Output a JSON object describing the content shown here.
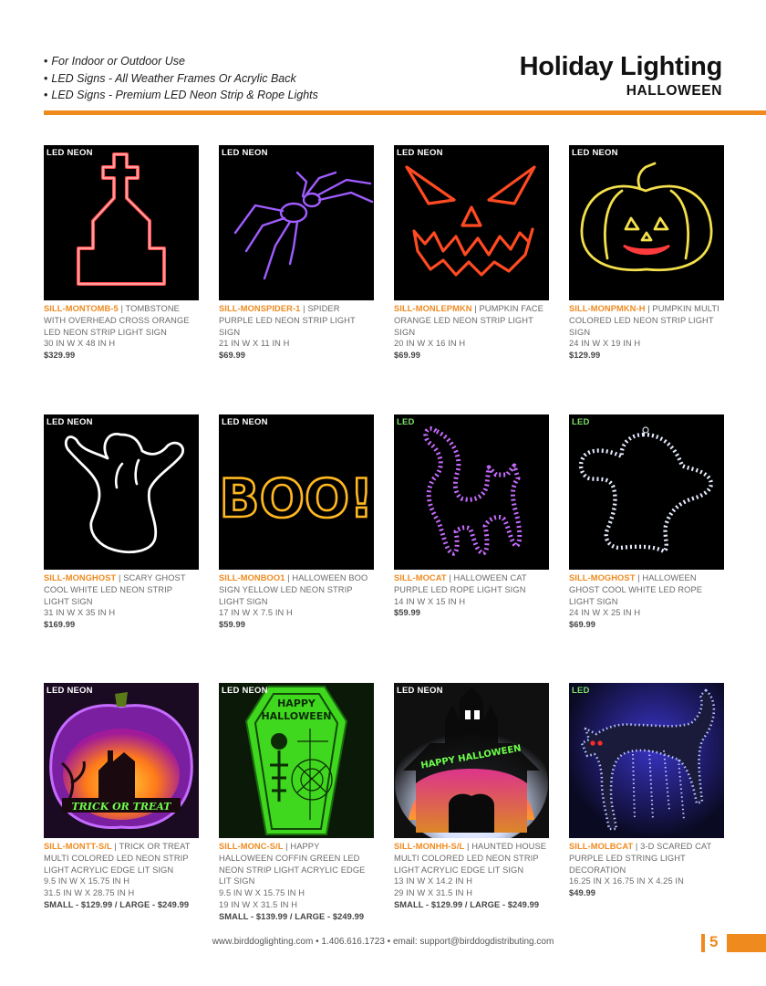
{
  "header": {
    "bullets": [
      "For Indoor or Outdoor Use",
      "LED Signs - All Weather Frames Or Acrylic Back",
      "LED Signs - Premium LED Neon Strip & Rope Lights"
    ],
    "title": "Holiday Lighting",
    "subtitle": "HALLOWEEN"
  },
  "colors": {
    "accent": "#ef8a1f",
    "led_tag": "#7ee06a"
  },
  "products": [
    {
      "tag": "LED NEON",
      "tag_type": "neon",
      "icon": "tombstone-cross-icon",
      "sku": "SILL-MONTOMB-5",
      "desc": "TOMBSTONE WITH OVERHEAD CROSS ORANGE LED NEON STRIP LIGHT SIGN",
      "dims": [
        "30 IN W X 48 IN H"
      ],
      "price": "$329.99"
    },
    {
      "tag": "LED NEON",
      "tag_type": "neon",
      "icon": "spider-icon",
      "sku": "SILL-MONSPIDER-1",
      "desc": "SPIDER PURPLE LED NEON STRIP LIGHT SIGN",
      "dims": [
        "21 IN W X 11 IN H"
      ],
      "price": "$69.99"
    },
    {
      "tag": "LED NEON",
      "tag_type": "neon",
      "icon": "pumpkin-face-icon",
      "sku": "SILL-MONLEPMKN",
      "desc": "PUMPKIN FACE ORANGE LED NEON STRIP LIGHT SIGN",
      "dims": [
        "20 IN W X 16 IN H"
      ],
      "price": "$69.99"
    },
    {
      "tag": "LED NEON",
      "tag_type": "neon",
      "icon": "pumpkin-icon",
      "sku": "SILL-MONPMKN-H",
      "desc": "PUMPKIN MULTI COLORED LED NEON STRIP LIGHT SIGN",
      "dims": [
        "24 IN W X 19 IN H"
      ],
      "price": "$129.99"
    },
    {
      "tag": "LED NEON",
      "tag_type": "neon",
      "icon": "scary-ghost-icon",
      "sku": "SILL-MONGHOST",
      "desc": "SCARY GHOST COOL WHITE LED NEON STRIP LIGHT SIGN",
      "dims": [
        "31 IN W X 35 IN H"
      ],
      "price": "$169.99"
    },
    {
      "tag": "LED NEON",
      "tag_type": "neon",
      "icon": "boo-text-icon",
      "sku": "SILL-MONBOO1",
      "desc": "HALLOWEEN BOO SIGN YELLOW LED NEON STRIP LIGHT SIGN",
      "dims": [
        "17 IN W X 7.5 IN H"
      ],
      "price": "$59.99"
    },
    {
      "tag": "LED",
      "tag_type": "led",
      "icon": "cat-icon",
      "sku": "SILL-MOCAT",
      "desc": "HALLOWEEN CAT PURPLE LED ROPE LIGHT SIGN",
      "dims": [
        "14 IN W X 15 IN H"
      ],
      "price": "$59.99"
    },
    {
      "tag": "LED",
      "tag_type": "led",
      "icon": "ghost-icon",
      "sku": "SILL-MOGHOST",
      "desc": "HALLOWEEN GHOST COOL WHITE LED ROPE LIGHT SIGN",
      "dims": [
        "24 IN W X 25 IN H"
      ],
      "price": "$69.99"
    },
    {
      "tag": "LED NEON",
      "tag_type": "neon",
      "icon": "trick-or-treat-pumpkin-icon",
      "sku": "SILL-MONTT-S/L",
      "desc": "TRICK OR TREAT MULTI COLORED LED NEON STRIP LIGHT ACRYLIC EDGE LIT SIGN",
      "dims": [
        "9.5 IN W X 15.75 IN H",
        "31.5 IN W x 28.75 IN H"
      ],
      "price": "SMALL - $129.99 / LARGE - $249.99"
    },
    {
      "tag": "LED NEON",
      "tag_type": "neon",
      "icon": "coffin-icon",
      "sku": "SILL-MONC-S/L",
      "desc": "HAPPY HALLOWEEN COFFIN GREEN LED NEON STRIP LIGHT ACRYLIC EDGE LIT SIGN",
      "dims": [
        "9.5 IN W X 15.75 IN H",
        "19 IN W x 31.5 IN H"
      ],
      "price": "SMALL - $139.99 / LARGE - $249.99"
    },
    {
      "tag": "LED NEON",
      "tag_type": "neon",
      "icon": "haunted-house-icon",
      "sku": "SILL-MONHH-S/L",
      "desc": "HAUNTED HOUSE MULTI COLORED LED NEON STRIP LIGHT ACRYLIC EDGE LIT SIGN",
      "dims": [
        "13 IN W X 14.2 IN H",
        "29 IN W x 31.5 IN H"
      ],
      "price": "SMALL - $129.99 / LARGE - $249.99"
    },
    {
      "tag": "LED",
      "tag_type": "led",
      "icon": "scared-cat-icon",
      "sku": "SILL-MOLBCAT",
      "desc": "3-D SCARED CAT PURPLE LED STRING LIGHT DECORATION",
      "dims": [
        "16.25 IN X 16.75 IN X 4.25 IN"
      ],
      "price": "$49.99"
    }
  ],
  "images": {
    "boo_text": "BOO!",
    "coffin_text_1": "HAPPY",
    "coffin_text_2": "HALLOWEEN",
    "pumpkin_text": "TRICK OR TREAT",
    "house_text": "HAPPY HALLOWEEN"
  },
  "footer": {
    "text": "www.birddoglighting.com • 1.406.616.1723 • email: support@birddogdistributing.com",
    "page_number": "5"
  }
}
